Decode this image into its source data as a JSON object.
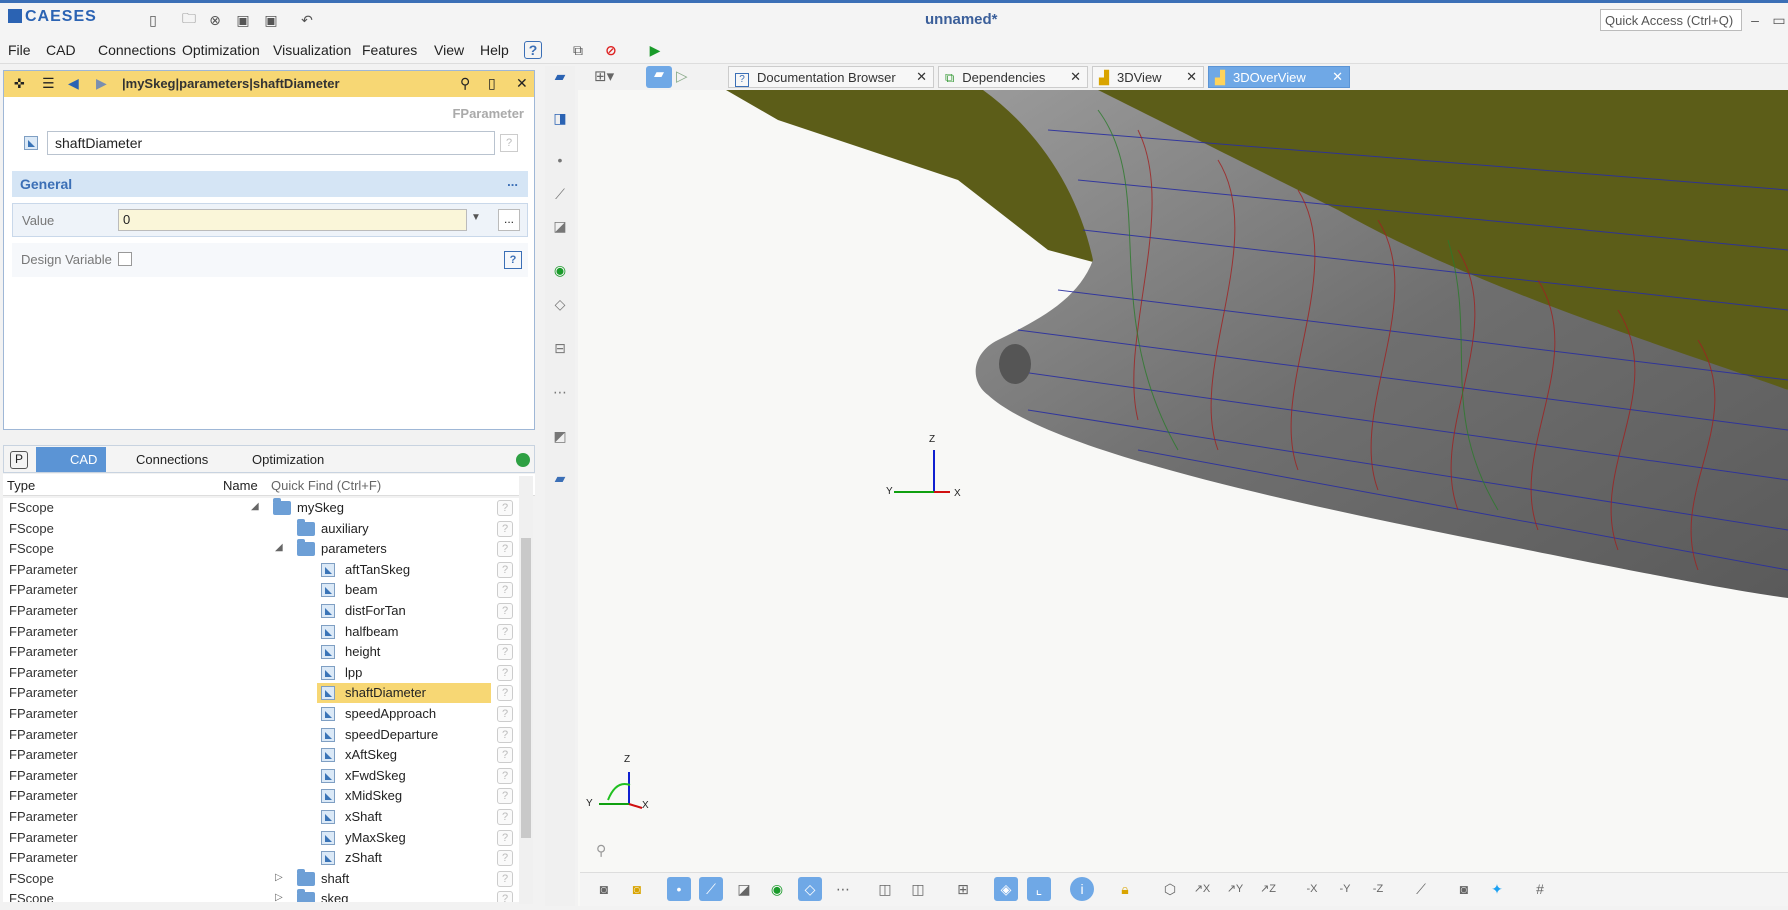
{
  "app": {
    "logo": "CAESES",
    "title": "unnamed*",
    "quick_access": "Quick Access (Ctrl+Q)"
  },
  "menu": [
    "File",
    "CAD",
    "Connections",
    "Optimization",
    "Visualization",
    "Features",
    "View",
    "Help"
  ],
  "object_panel": {
    "breadcrumb": "|mySkeg|parameters|shaftDiameter",
    "type": "FParameter",
    "name": "shaftDiameter",
    "section": "General",
    "section_menu": "...",
    "value_label": "Value",
    "value": "0",
    "value_more": "...",
    "design_variable_label": "Design Variable"
  },
  "bottom_tabs": {
    "p": "P",
    "cad": "CAD",
    "connections": "Connections",
    "optimization": "Optimization"
  },
  "tree": {
    "col_type": "Type",
    "col_name": "Name",
    "quick_find": "Quick Find (Ctrl+F)",
    "rows": [
      {
        "type": "FScope",
        "name": "mySkeg",
        "kind": "folder",
        "level": 0,
        "expand": "◢"
      },
      {
        "type": "FScope",
        "name": "auxiliary",
        "kind": "folder",
        "level": 1,
        "expand": ""
      },
      {
        "type": "FScope",
        "name": "parameters",
        "kind": "folder",
        "level": 1,
        "expand": "◢"
      },
      {
        "type": "FParameter",
        "name": "aftTanSkeg",
        "kind": "param",
        "level": 2,
        "expand": ""
      },
      {
        "type": "FParameter",
        "name": "beam",
        "kind": "param",
        "level": 2,
        "expand": ""
      },
      {
        "type": "FParameter",
        "name": "distForTan",
        "kind": "param",
        "level": 2,
        "expand": ""
      },
      {
        "type": "FParameter",
        "name": "halfbeam",
        "kind": "param",
        "level": 2,
        "expand": ""
      },
      {
        "type": "FParameter",
        "name": "height",
        "kind": "param",
        "level": 2,
        "expand": ""
      },
      {
        "type": "FParameter",
        "name": "lpp",
        "kind": "param",
        "level": 2,
        "expand": ""
      },
      {
        "type": "FParameter",
        "name": "shaftDiameter",
        "kind": "param",
        "level": 2,
        "expand": "",
        "selected": true
      },
      {
        "type": "FParameter",
        "name": "speedApproach",
        "kind": "param",
        "level": 2,
        "expand": ""
      },
      {
        "type": "FParameter",
        "name": "speedDeparture",
        "kind": "param",
        "level": 2,
        "expand": ""
      },
      {
        "type": "FParameter",
        "name": "xAftSkeg",
        "kind": "param",
        "level": 2,
        "expand": ""
      },
      {
        "type": "FParameter",
        "name": "xFwdSkeg",
        "kind": "param",
        "level": 2,
        "expand": ""
      },
      {
        "type": "FParameter",
        "name": "xMidSkeg",
        "kind": "param",
        "level": 2,
        "expand": ""
      },
      {
        "type": "FParameter",
        "name": "xShaft",
        "kind": "param",
        "level": 2,
        "expand": ""
      },
      {
        "type": "FParameter",
        "name": "yMaxSkeg",
        "kind": "param",
        "level": 2,
        "expand": ""
      },
      {
        "type": "FParameter",
        "name": "zShaft",
        "kind": "param",
        "level": 2,
        "expand": ""
      },
      {
        "type": "FScope",
        "name": "shaft",
        "kind": "folder",
        "level": 1,
        "expand": "▷"
      },
      {
        "type": "FScope",
        "name": "skeg",
        "kind": "folder",
        "level": 1,
        "expand": "▷"
      }
    ]
  },
  "view_tabs": [
    "Documentation Browser",
    "Dependencies",
    "3DView",
    "3DOverView"
  ],
  "axes": {
    "z": "Z",
    "y": "Y",
    "x": "X"
  }
}
